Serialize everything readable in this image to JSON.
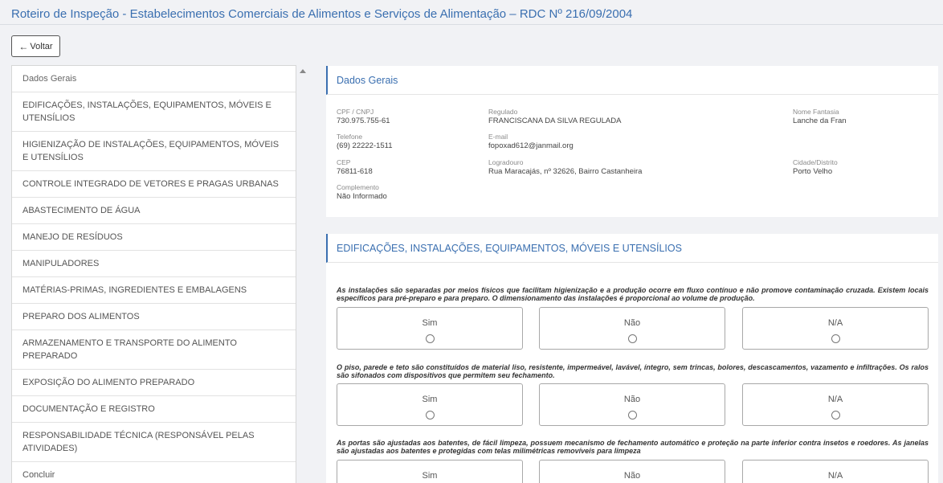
{
  "header": {
    "title": "Roteiro de Inspeção - Estabelecimentos Comerciais de Alimentos e Serviços de Alimentação – RDC Nº 216/09/2004",
    "back_label": "Voltar"
  },
  "sidebar": {
    "items": [
      {
        "label": "Dados Gerais"
      },
      {
        "label": "EDIFICAÇÕES, INSTALAÇÕES, EQUIPAMENTOS, MÓVEIS E UTENSÍLIOS"
      },
      {
        "label": "HIGIENIZAÇÃO DE INSTALAÇÕES, EQUIPAMENTOS, MÓVEIS E UTENSÍLIOS"
      },
      {
        "label": "CONTROLE INTEGRADO DE VETORES E PRAGAS URBANAS"
      },
      {
        "label": "ABASTECIMENTO DE ÁGUA"
      },
      {
        "label": "MANEJO DE RESÍDUOS"
      },
      {
        "label": "MANIPULADORES"
      },
      {
        "label": "MATÉRIAS-PRIMAS, INGREDIENTES E EMBALAGENS"
      },
      {
        "label": "PREPARO DOS ALIMENTOS"
      },
      {
        "label": "ARMAZENAMENTO E TRANSPORTE DO ALIMENTO PREPARADO"
      },
      {
        "label": "EXPOSIÇÃO DO ALIMENTO PREPARADO"
      },
      {
        "label": "DOCUMENTAÇÃO E REGISTRO"
      },
      {
        "label": "RESPONSABILIDADE TÉCNICA (RESPONSÁVEL PELAS ATIVIDADES)"
      },
      {
        "label": "Concluir"
      }
    ]
  },
  "dados_gerais": {
    "title": "Dados Gerais",
    "cpf_label": "CPF / CNPJ",
    "cpf_value": "730.975.755-61",
    "regulado_label": "Regulado",
    "regulado_value": "FRANCISCANA DA SILVA REGULADA",
    "fantasia_label": "Nome Fantasia",
    "fantasia_value": "Lanche da Fran",
    "telefone_label": "Telefone",
    "telefone_value": "(69) 22222-1511",
    "email_label": "E-mail",
    "email_value": "fopoxad612@janmail.org",
    "cep_label": "CEP",
    "cep_value": "76811-618",
    "logradouro_label": "Logradouro",
    "logradouro_value": "Rua Maracajás, nº 32626, Bairro Castanheira",
    "cidade_label": "Cidade/Distrito",
    "cidade_value": "Porto Velho",
    "complemento_label": "Complemento",
    "complemento_value": "Não Informado"
  },
  "edificacoes": {
    "title": "EDIFICAÇÕES, INSTALAÇÕES, EQUIPAMENTOS, MÓVEIS E UTENSÍLIOS",
    "options": [
      "Sim",
      "Não",
      "N/A"
    ],
    "questions": [
      "As instalações são separadas por meios físicos que facilitam higienização e a produção ocorre em fluxo contínuo e não promove contaminação cruzada. Existem locais específicos para pré-preparo e para preparo. O dimensionamento das instalações é proporcional ao volume de produção.",
      "O piso, parede e teto são constituídos de material liso, resistente, impermeável, lavável, íntegro, sem trincas, bolores, descascamentos, vazamento e infiltrações. Os ralos são sifonados com dispositivos que permitem seu fechamento.",
      "As portas são ajustadas aos batentes, de fácil limpeza, possuem mecanismo de fechamento automático e proteção na parte inferior contra insetos e roedores. As janelas são ajustadas aos batentes e protegidas com telas milimétricas removíveis para limpeza"
    ]
  }
}
